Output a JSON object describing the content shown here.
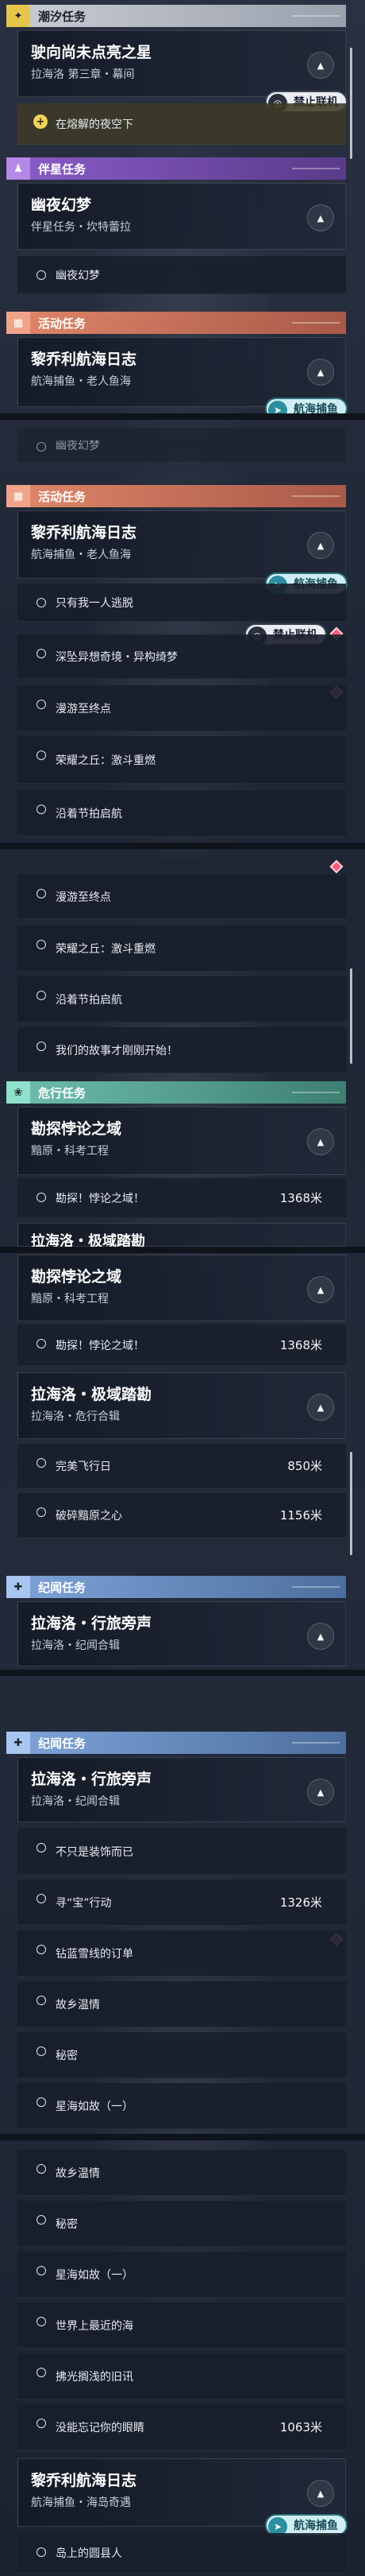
{
  "categories": {
    "tide": "潮汐任务",
    "companion": "伴星任务",
    "event": "活动任务",
    "danger": "危行任务",
    "journal": "纪闻任务"
  },
  "icons": {
    "tide": "sparkle-icon",
    "companion": "person-icon",
    "event": "calendar-icon",
    "danger": "flower-icon",
    "journal": "plus-star-icon",
    "collapse": "chevron-up-icon",
    "target": "target-icon",
    "no_connect": "lock-icon",
    "fishing": "fish-icon"
  },
  "badges": {
    "no_connect": "禁止联机",
    "fishing": "航海捕鱼"
  },
  "quests": {
    "star": {
      "title": "驶向尚未点亮之星",
      "sub": "拉海洛 第三章・幕间"
    },
    "star_obj": "在熔解的夜空下",
    "dream": {
      "title": "幽夜幻梦",
      "sub": "伴星任务・坎特蕾拉"
    },
    "dream_obj": "幽夜幻梦",
    "log": {
      "title": "黎乔利航海日志",
      "sub": "航海捕鱼・老人鱼海"
    },
    "log2": {
      "title": "黎乔利航海日志",
      "sub": "航海捕鱼・海岛奇遇"
    },
    "explore": {
      "title": "勘探悖论之域",
      "sub": "黯原・科考工程"
    },
    "extreme": {
      "title": "拉海洛・极域踏勘",
      "sub": "拉海洛・危行合辑"
    },
    "travel": {
      "title": "拉海洛・行旅旁声",
      "sub": "拉海洛・纪闻合辑"
    }
  },
  "objectives": {
    "alone": "只有我一人逃脱",
    "deepsea": "深坠异想奇境・异构绮梦",
    "wander": "漫游至终点",
    "glory": "荣耀之丘：激斗重燃",
    "relay": "沿着节拍启航",
    "story": "我们的故事才刚刚开始！",
    "paradox": "勘探！悖论之域！",
    "perfect": "完美飞行日",
    "break": "破碎黯原之心",
    "nopure": "不只是装饰而已",
    "findtreasure": "寻“宝”行动",
    "snow": "钻蓝雪线的订单",
    "home": "故乡温情",
    "secret": "秘密",
    "starsea": "星海如故（一）",
    "nearest": "世界上最近的海",
    "lighthouse": "拂光搁浅的旧讯",
    "eyes": "没能忘记你的眼睛",
    "islander": "岛上的圆县人",
    "extreme_cut": "拉海洛・危行合辑",
    "nopure_cut": "不只是装饰而已"
  },
  "distances": {
    "paradox": "1368米",
    "perfect": "850米",
    "break": "1156米",
    "findtreasure": "1326米",
    "eyes": "1063米"
  },
  "colors": {
    "tide": "#c9ccd3",
    "companion": "#8a5cc9",
    "event": "#e0866a",
    "danger": "#6fbfae",
    "journal": "#7fa4d9",
    "marker": "#ff5a7a"
  }
}
